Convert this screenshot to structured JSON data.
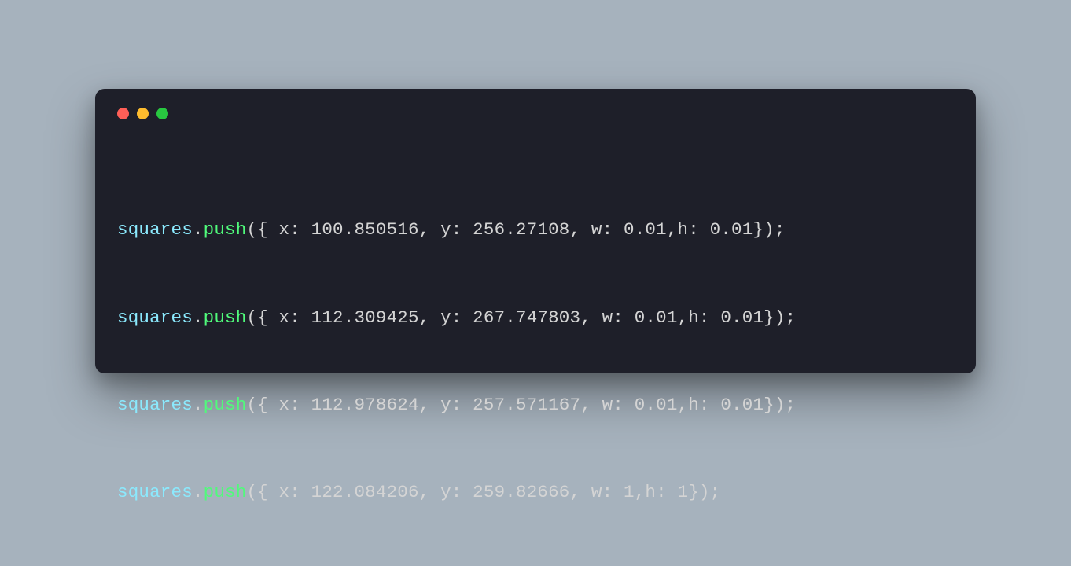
{
  "code_lines": [
    {
      "object": "squares",
      "method": "push",
      "content_after_open": " x: 100.850516, y: 256.27108, w: 0.01,h: 0.01});"
    },
    {
      "object": "squares",
      "method": "push",
      "content_after_open": " x: 112.309425, y: 267.747803, w: 0.01,h: 0.01});"
    },
    {
      "object": "squares",
      "method": "push",
      "content_after_open": " x: 112.978624, y: 257.571167, w: 0.01,h: 0.01});"
    },
    {
      "object": "squares",
      "method": "push",
      "content_after_open": " x: 122.084206, y: 259.82666, w: 1,h: 1});"
    }
  ]
}
